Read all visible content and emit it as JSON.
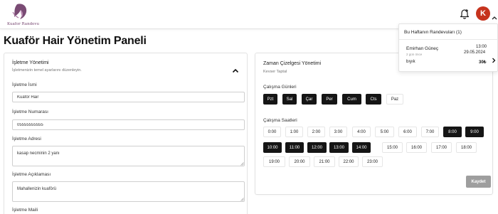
{
  "brand": {
    "logo_text": "Kuafor Randevu",
    "avatar_letter": "K",
    "avatar_color": "#c6331d"
  },
  "header": {
    "bell_icon": "bell-plus-icon",
    "menu_chevron_icon": "chevron-up-icon"
  },
  "page": {
    "title": "Kuaför Hair Yönetim Paneli"
  },
  "business_card": {
    "title": "İşletme Yönetimi",
    "subtitle": "İşletmenizin temel ayarlarını düzenleyin.",
    "fields": {
      "name": {
        "label": "İşletme İsmi",
        "value": "Kuaför Hair"
      },
      "phone": {
        "label": "İşletme Numarası",
        "value": "05555555555"
      },
      "address": {
        "label": "İşletme Adresi",
        "value": "kasap necminin 2 yanı"
      },
      "description": {
        "label": "İşletme Açıklaması",
        "value": "Mahallenizin kuaförü"
      },
      "email": {
        "label": "İşletme Maili"
      }
    }
  },
  "schedule_card": {
    "title": "Zaman Çizelgesi Yönetimi",
    "subtitle": "Kevser Taptal",
    "days_label": "Çalışma Günleri",
    "days": [
      {
        "label": "Pzt",
        "active": true
      },
      {
        "label": "Sal",
        "active": true
      },
      {
        "label": "Çar",
        "active": true
      },
      {
        "label": "Per",
        "active": true
      },
      {
        "label": "Cum",
        "active": true
      },
      {
        "label": "Cts",
        "active": true
      },
      {
        "label": "Paz",
        "active": false
      }
    ],
    "hours_label": "Çalışma Saatleri",
    "hours": [
      {
        "label": "0:00",
        "active": false
      },
      {
        "label": "1:00",
        "active": false
      },
      {
        "label": "2:00",
        "active": false
      },
      {
        "label": "3:00",
        "active": false
      },
      {
        "label": "4:00",
        "active": false
      },
      {
        "label": "5:00",
        "active": false
      },
      {
        "label": "6:00",
        "active": false
      },
      {
        "label": "7:00",
        "active": false
      },
      {
        "label": "8:00",
        "active": true
      },
      {
        "label": "9:00",
        "active": true
      },
      {
        "label": "10:00",
        "active": true
      },
      {
        "label": "11:00",
        "active": true
      },
      {
        "label": "12:00",
        "active": true
      },
      {
        "label": "13:00",
        "active": true
      },
      {
        "label": "14:00",
        "active": true
      },
      {
        "label": "15:00",
        "active": false
      },
      {
        "label": "16:00",
        "active": false
      },
      {
        "label": "17:00",
        "active": false
      },
      {
        "label": "18:00",
        "active": false
      },
      {
        "label": "19:00",
        "active": false
      },
      {
        "label": "20:00",
        "active": false
      },
      {
        "label": "21:00",
        "active": false
      },
      {
        "label": "22:00",
        "active": false
      },
      {
        "label": "23:00",
        "active": false
      }
    ],
    "save_label": "Kaydet"
  },
  "appointments_dropdown": {
    "title": "Bu Haftanın Randevuları (1)",
    "items": [
      {
        "name": "Emirhan Güneç",
        "ago": "2 gün önce",
        "time": "13:00",
        "date": "29.05.2024",
        "service": "bıyık",
        "price": "30₺"
      }
    ]
  }
}
